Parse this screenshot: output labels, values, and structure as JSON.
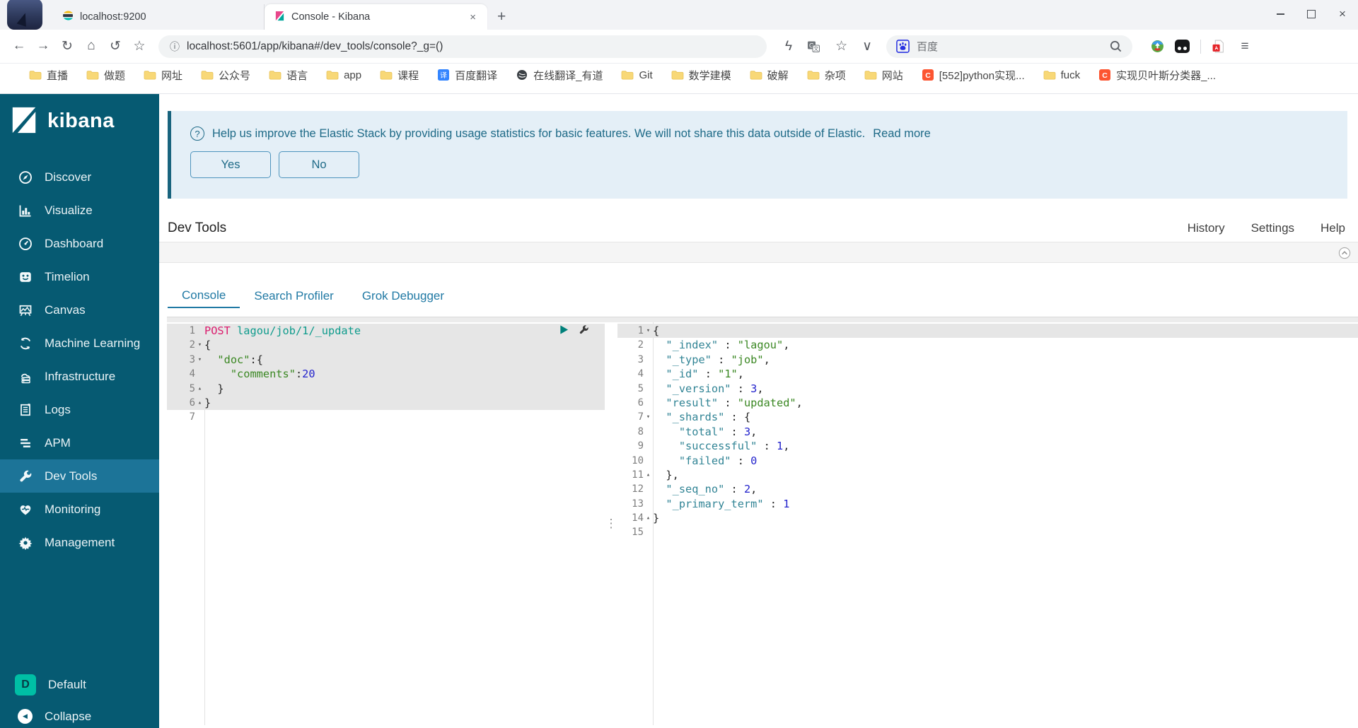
{
  "browser": {
    "tabs": [
      {
        "title": "localhost:9200",
        "icon": "elasticsearch-favicon"
      },
      {
        "title": "Console - Kibana",
        "icon": "kibana-favicon",
        "active": true
      }
    ],
    "url": "localhost:5601/app/kibana#/dev_tools/console?_g=()",
    "toolbar_icons": [
      "back-icon",
      "forward-icon",
      "refresh-icon",
      "home-icon",
      "undo-icon",
      "star-outline-icon"
    ],
    "address_icons": [
      "lightning-icon",
      "translate-icon",
      "star-outline-icon",
      "dropdown-chevron-icon"
    ],
    "search": {
      "engine_label": "百度",
      "engine_icon": "baidu-icon",
      "search_icon": "search-icon"
    },
    "right_icons": [
      "idm-icon",
      "extension-icon",
      "divider",
      "pdf-icon",
      "menu-icon"
    ],
    "bookmarks": [
      {
        "label": "直播",
        "icon": "folder-icon"
      },
      {
        "label": "做题",
        "icon": "folder-icon"
      },
      {
        "label": "网址",
        "icon": "folder-icon"
      },
      {
        "label": "公众号",
        "icon": "folder-icon"
      },
      {
        "label": "语言",
        "icon": "folder-icon"
      },
      {
        "label": "app",
        "icon": "folder-icon"
      },
      {
        "label": "课程",
        "icon": "folder-icon"
      },
      {
        "label": "百度翻译",
        "icon": "translate-badge-icon"
      },
      {
        "label": "在线翻译_有道",
        "icon": "globe-icon"
      },
      {
        "label": "Git",
        "icon": "folder-icon"
      },
      {
        "label": "数学建模",
        "icon": "folder-icon"
      },
      {
        "label": "破解",
        "icon": "folder-icon"
      },
      {
        "label": "杂项",
        "icon": "folder-icon"
      },
      {
        "label": "网站",
        "icon": "folder-icon"
      },
      {
        "label": "[552]python实现...",
        "icon": "csdn-icon"
      },
      {
        "label": "fuck",
        "icon": "folder-icon"
      },
      {
        "label": "实现贝叶斯分类器_...",
        "icon": "csdn-icon"
      }
    ]
  },
  "sidebar": {
    "logo_text": "kibana",
    "items": [
      {
        "label": "Discover",
        "icon": "discover-icon"
      },
      {
        "label": "Visualize",
        "icon": "visualize-icon"
      },
      {
        "label": "Dashboard",
        "icon": "dashboard-icon"
      },
      {
        "label": "Timelion",
        "icon": "timelion-icon"
      },
      {
        "label": "Canvas",
        "icon": "canvas-icon"
      },
      {
        "label": "Machine Learning",
        "icon": "machine-learning-icon"
      },
      {
        "label": "Infrastructure",
        "icon": "infrastructure-icon"
      },
      {
        "label": "Logs",
        "icon": "logs-icon"
      },
      {
        "label": "APM",
        "icon": "apm-icon"
      },
      {
        "label": "Dev Tools",
        "icon": "wrench-icon",
        "active": true
      },
      {
        "label": "Monitoring",
        "icon": "monitoring-icon"
      },
      {
        "label": "Management",
        "icon": "gear-icon"
      }
    ],
    "footer": [
      {
        "label": "Default",
        "badge": "D"
      },
      {
        "label": "Collapse",
        "icon": "collapse-arrow-icon"
      }
    ]
  },
  "banner": {
    "message": "Help us improve the Elastic Stack by providing usage statistics for basic features. We will not share this data outside of Elastic.",
    "link_label": "Read more",
    "yes_label": "Yes",
    "no_label": "No"
  },
  "devtools": {
    "title": "Dev Tools",
    "menu": [
      "History",
      "Settings",
      "Help"
    ],
    "tabs": [
      {
        "label": "Console",
        "active": true
      },
      {
        "label": "Search Profiler",
        "active": false
      },
      {
        "label": "Grok Debugger",
        "active": false
      }
    ]
  },
  "console_editor": {
    "request": {
      "lines": [
        {
          "n": 1,
          "hl": true,
          "actions": true,
          "fold": "",
          "tokens": [
            [
              "POST ",
              "method"
            ],
            [
              "lagou/job/1/_update",
              "url"
            ]
          ]
        },
        {
          "n": 2,
          "hl": true,
          "fold": "open",
          "tokens": [
            [
              "{",
              "punc"
            ]
          ]
        },
        {
          "n": 3,
          "hl": true,
          "fold": "open",
          "tokens": [
            [
              "  ",
              "punc"
            ],
            [
              "\"doc\"",
              "str"
            ],
            [
              ":{",
              "punc"
            ]
          ]
        },
        {
          "n": 4,
          "hl": true,
          "fold": "",
          "tokens": [
            [
              "    ",
              "punc"
            ],
            [
              "\"comments\"",
              "str"
            ],
            [
              ":",
              "punc"
            ],
            [
              "20",
              "num"
            ]
          ]
        },
        {
          "n": 5,
          "hl": true,
          "fold": "close",
          "tokens": [
            [
              "  }",
              "punc"
            ]
          ]
        },
        {
          "n": 6,
          "hl": true,
          "fold": "close",
          "tokens": [
            [
              "}",
              "punc"
            ]
          ]
        },
        {
          "n": 7,
          "hl": false,
          "fold": "",
          "tokens": []
        }
      ]
    },
    "response": {
      "lines": [
        {
          "n": 1,
          "hl": true,
          "fold": "open",
          "tokens": [
            [
              "{",
              "punc"
            ]
          ]
        },
        {
          "n": 2,
          "fold": "",
          "tokens": [
            [
              "  ",
              "punc"
            ],
            [
              "\"_index\"",
              "key"
            ],
            [
              " : ",
              "punc"
            ],
            [
              "\"lagou\"",
              "str"
            ],
            [
              ",",
              "punc"
            ]
          ]
        },
        {
          "n": 3,
          "fold": "",
          "tokens": [
            [
              "  ",
              "punc"
            ],
            [
              "\"_type\"",
              "key"
            ],
            [
              " : ",
              "punc"
            ],
            [
              "\"job\"",
              "str"
            ],
            [
              ",",
              "punc"
            ]
          ]
        },
        {
          "n": 4,
          "fold": "",
          "tokens": [
            [
              "  ",
              "punc"
            ],
            [
              "\"_id\"",
              "key"
            ],
            [
              " : ",
              "punc"
            ],
            [
              "\"1\"",
              "str"
            ],
            [
              ",",
              "punc"
            ]
          ]
        },
        {
          "n": 5,
          "fold": "",
          "tokens": [
            [
              "  ",
              "punc"
            ],
            [
              "\"_version\"",
              "key"
            ],
            [
              " : ",
              "punc"
            ],
            [
              "3",
              "num"
            ],
            [
              ",",
              "punc"
            ]
          ]
        },
        {
          "n": 6,
          "fold": "",
          "tokens": [
            [
              "  ",
              "punc"
            ],
            [
              "\"result\"",
              "key"
            ],
            [
              " : ",
              "punc"
            ],
            [
              "\"updated\"",
              "str"
            ],
            [
              ",",
              "punc"
            ]
          ]
        },
        {
          "n": 7,
          "fold": "open",
          "tokens": [
            [
              "  ",
              "punc"
            ],
            [
              "\"_shards\"",
              "key"
            ],
            [
              " : {",
              "punc"
            ]
          ]
        },
        {
          "n": 8,
          "fold": "",
          "tokens": [
            [
              "    ",
              "punc"
            ],
            [
              "\"total\"",
              "key"
            ],
            [
              " : ",
              "punc"
            ],
            [
              "3",
              "num"
            ],
            [
              ",",
              "punc"
            ]
          ]
        },
        {
          "n": 9,
          "fold": "",
          "tokens": [
            [
              "    ",
              "punc"
            ],
            [
              "\"successful\"",
              "key"
            ],
            [
              " : ",
              "punc"
            ],
            [
              "1",
              "num"
            ],
            [
              ",",
              "punc"
            ]
          ]
        },
        {
          "n": 10,
          "fold": "",
          "tokens": [
            [
              "    ",
              "punc"
            ],
            [
              "\"failed\"",
              "key"
            ],
            [
              " : ",
              "punc"
            ],
            [
              "0",
              "num"
            ]
          ]
        },
        {
          "n": 11,
          "fold": "close",
          "tokens": [
            [
              "  },",
              "punc"
            ]
          ]
        },
        {
          "n": 12,
          "fold": "",
          "tokens": [
            [
              "  ",
              "punc"
            ],
            [
              "\"_seq_no\"",
              "key"
            ],
            [
              " : ",
              "punc"
            ],
            [
              "2",
              "num"
            ],
            [
              ",",
              "punc"
            ]
          ]
        },
        {
          "n": 13,
          "fold": "",
          "tokens": [
            [
              "  ",
              "punc"
            ],
            [
              "\"_primary_term\"",
              "key"
            ],
            [
              " : ",
              "punc"
            ],
            [
              "1",
              "num"
            ]
          ]
        },
        {
          "n": 14,
          "fold": "close",
          "tokens": [
            [
              "}",
              "punc"
            ]
          ]
        },
        {
          "n": 15,
          "fold": "",
          "tokens": []
        }
      ]
    }
  },
  "colors": {
    "sidebar_bg": "#065A72",
    "sidebar_active": "#1C7498",
    "badge_teal": "#00BFA5",
    "banner_text": "#1E6A87",
    "tab_blue": "#2079A4",
    "method": "#DB1D6E",
    "url": "#0E9B8C",
    "str": "#3A8722",
    "key": "#318495",
    "num": "#2222CC",
    "punc": "#262626",
    "kibana_pink": "#E7478B",
    "kibana_teal": "#00A69B"
  }
}
